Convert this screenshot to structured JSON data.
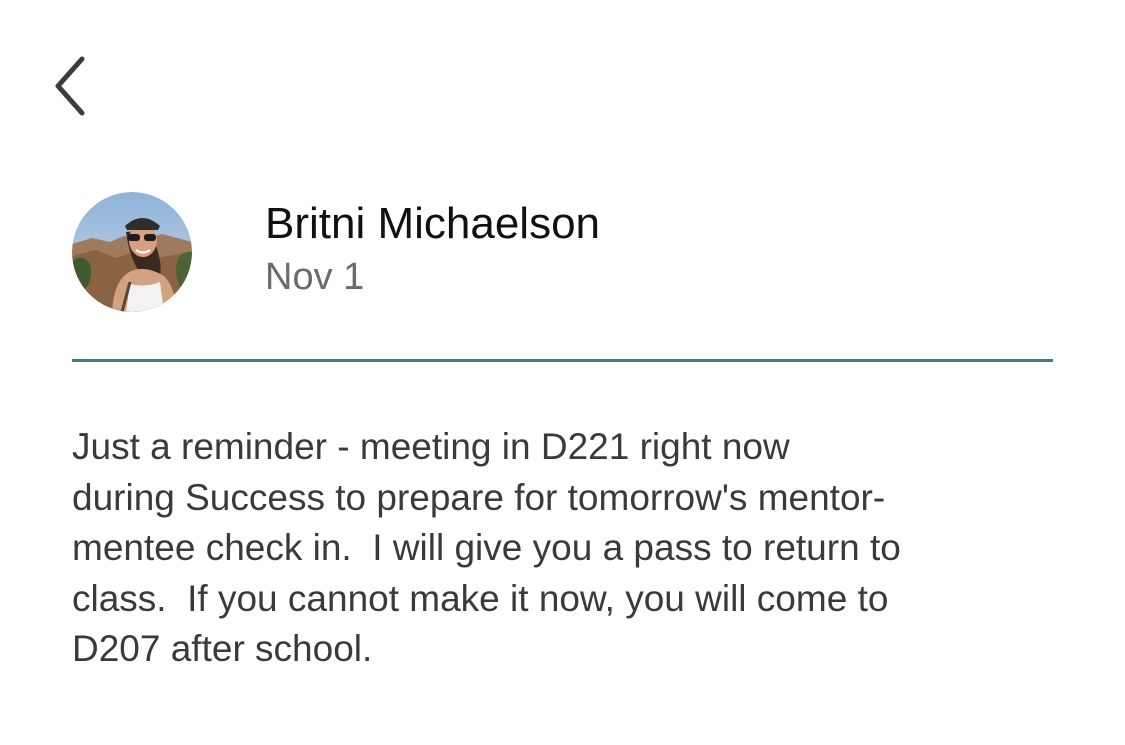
{
  "header": {
    "back_icon": "chevron-left-icon"
  },
  "post": {
    "author": "Britni Michaelson",
    "date": "Nov 1",
    "avatar_icon": "profile-photo",
    "divider_color": "#3f7f81",
    "message_lines": [
      "Just a reminder - meeting in D221 right now",
      "during Success to prepare for tomorrow's mentor-",
      "mentee check in.  I will give you a pass to return to",
      "class.  If you cannot make it now, you will come to",
      "D207 after school."
    ]
  }
}
